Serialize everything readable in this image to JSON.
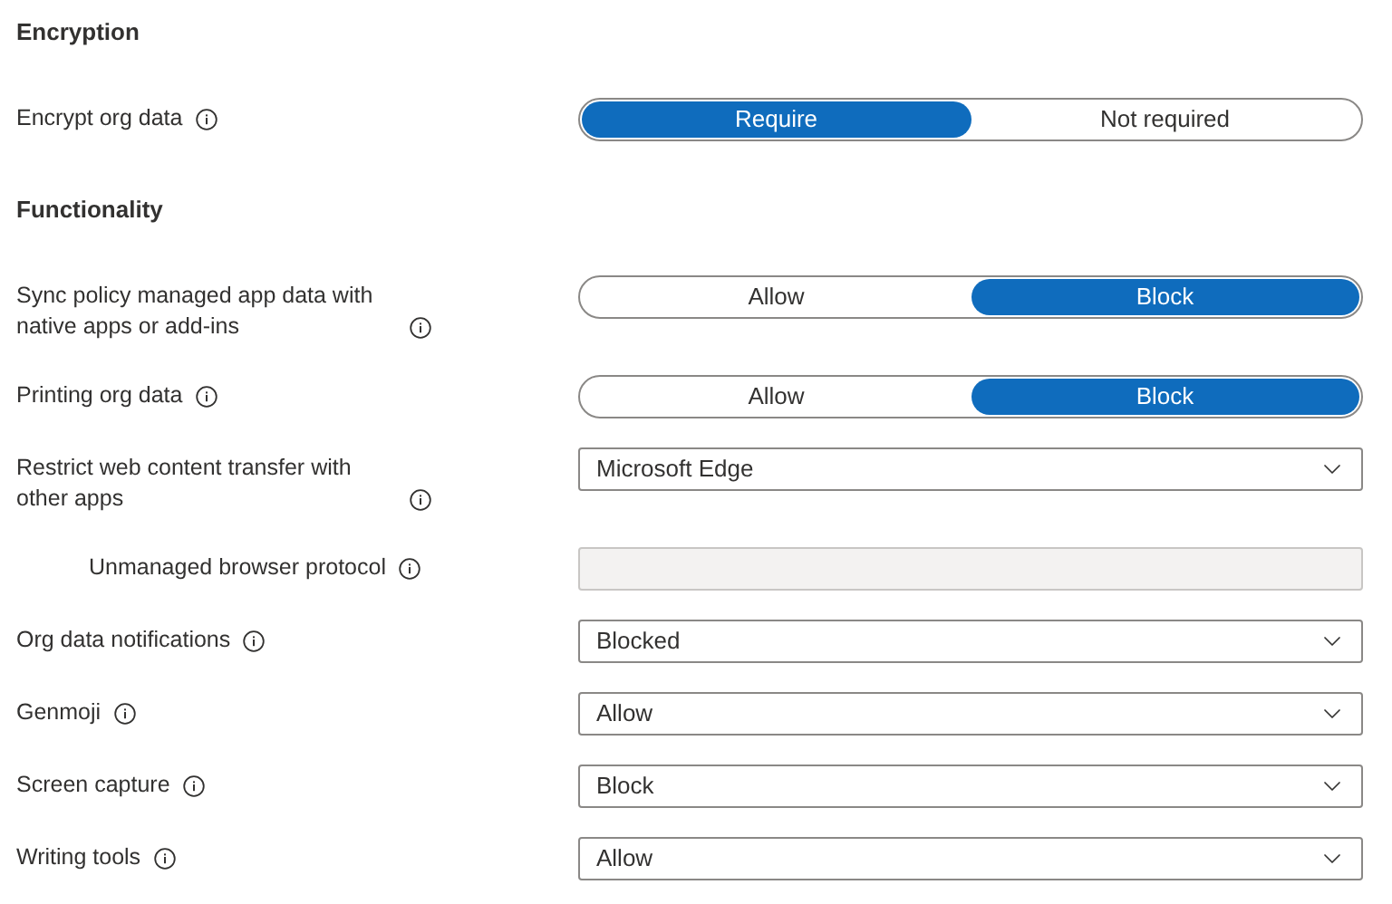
{
  "sections": [
    {
      "title": "Encryption",
      "settings": [
        {
          "kind": "toggle",
          "label": "Encrypt org data",
          "options": [
            {
              "label": "Require",
              "selected": true
            },
            {
              "label": "Not required",
              "selected": false
            }
          ]
        }
      ]
    },
    {
      "title": "Functionality",
      "settings": [
        {
          "kind": "toggle",
          "label": "Sync policy managed app data with native apps or add-ins",
          "options": [
            {
              "label": "Allow",
              "selected": false
            },
            {
              "label": "Block",
              "selected": true
            }
          ]
        },
        {
          "kind": "toggle",
          "label": "Printing org data",
          "options": [
            {
              "label": "Allow",
              "selected": false
            },
            {
              "label": "Block",
              "selected": true
            }
          ]
        },
        {
          "kind": "dropdown",
          "label": "Restrict web content transfer with other apps",
          "value": "Microsoft Edge",
          "children": [
            {
              "kind": "text",
              "label": "Unmanaged browser protocol",
              "disabled": true
            }
          ]
        },
        {
          "kind": "dropdown",
          "label": "Org data notifications",
          "value": "Blocked"
        },
        {
          "kind": "dropdown",
          "label": "Genmoji",
          "value": "Allow"
        },
        {
          "kind": "dropdown",
          "label": "Screen capture",
          "value": "Block"
        },
        {
          "kind": "dropdown",
          "label": "Writing tools",
          "value": "Allow"
        }
      ]
    }
  ]
}
